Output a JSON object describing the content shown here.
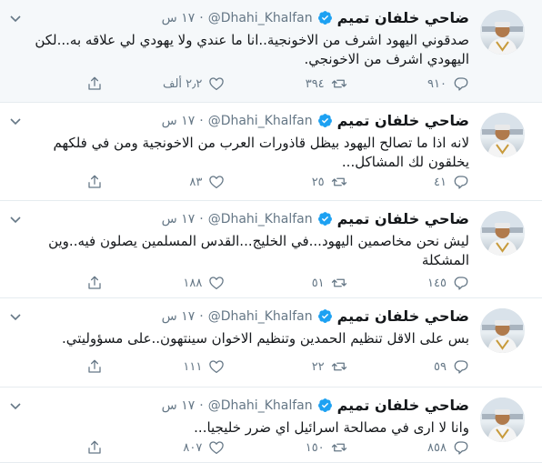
{
  "user": {
    "name": "ضاحي خلفان تميم",
    "handle": "@Dhahi_Khalfan",
    "verified_icon": "verified-badge-icon"
  },
  "colors": {
    "accent": "#1da1f2",
    "muted": "#657786",
    "highlight_bg": "#f5f8fa"
  },
  "tweets": [
    {
      "time": "١٧ س",
      "text": "صدقوني اليهود اشرف من الاخونجية..انا ما عندي ولا يهودي لي علاقه به...لكن اليهودي اشرف من الاخونجي.",
      "replies": "٩١٠",
      "retweets": "٣٩٤",
      "likes": "٢٫٢ ألف"
    },
    {
      "time": "١٧ س",
      "text": "لانه اذا ما تصالح اليهود بيظل قاذورات العرب من الاخونجية ومن في فلكهم يخلقون لك المشاكل...",
      "replies": "٤١",
      "retweets": "٢٥",
      "likes": "٨٣"
    },
    {
      "time": "١٧ س",
      "text": "ليش نحن مخاصمين اليهود...في الخليج...القدس المسلمين يصلون فيه..وين المشكلة",
      "replies": "١٤٥",
      "retweets": "٥١",
      "likes": "١٨٨"
    },
    {
      "time": "١٧ س",
      "text": "بس على الاقل تنظيم الحمدين وتنظيم الاخوان سينتهون..على مسؤوليتي.",
      "replies": "٥٩",
      "retweets": "٢٢",
      "likes": "١١١"
    },
    {
      "time": "١٧ س",
      "text": "وانا لا ارى في مصالحة اسرائيل اي ضرر خليجيا...",
      "replies": "٨٥٨",
      "retweets": "١٥٠",
      "likes": "٨٠٧"
    }
  ]
}
